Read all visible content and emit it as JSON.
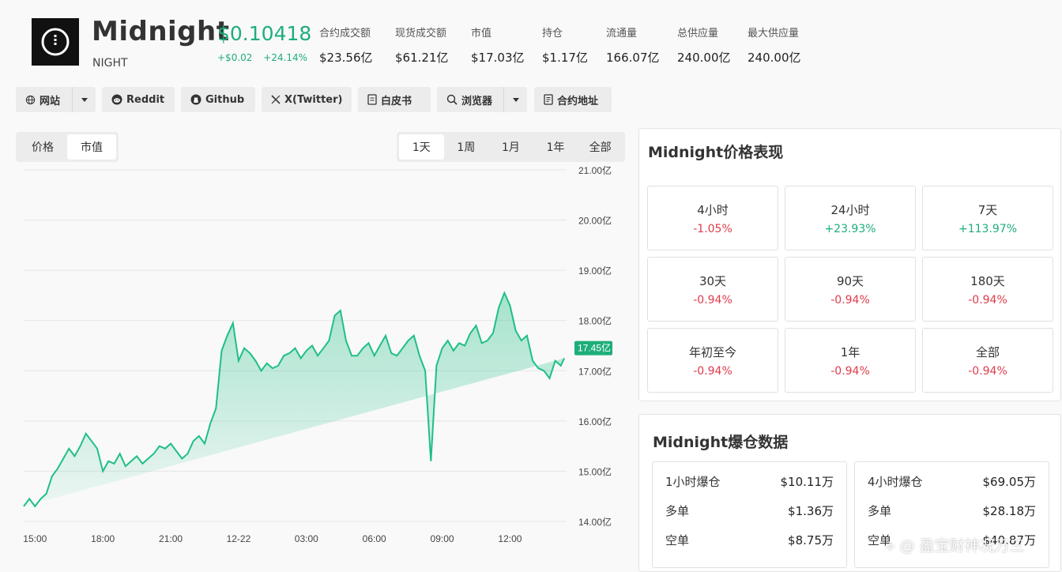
{
  "coin": {
    "name": "Midnight",
    "symbol": "NIGHT",
    "price": "$0.10418",
    "change_abs": "+$0.02",
    "change_pct": "+24.14%"
  },
  "stats": [
    {
      "label": "合约成交额",
      "value": "$23.56亿"
    },
    {
      "label": "现货成交额",
      "value": "$61.21亿"
    },
    {
      "label": "市值",
      "value": "$17.03亿"
    },
    {
      "label": "持仓",
      "value": "$1.17亿"
    },
    {
      "label": "流通量",
      "value": "166.07亿"
    },
    {
      "label": "总供应量",
      "value": "240.00亿"
    },
    {
      "label": "最大供应量",
      "value": "240.00亿"
    }
  ],
  "links": {
    "website": "网站",
    "reddit": "Reddit",
    "github": "Github",
    "twitter": "X(Twitter)",
    "whitepaper": "白皮书",
    "explorer": "浏览器",
    "contract": "合约地址"
  },
  "chart_toggle": {
    "price": "价格",
    "market_cap": "市值",
    "active": "市值"
  },
  "ranges": [
    "1天",
    "1周",
    "1月",
    "1年",
    "全部"
  ],
  "active_range": "1天",
  "chart_data": {
    "type": "area",
    "title": "",
    "xlabel": "",
    "ylabel": "",
    "unit": "亿",
    "color": "#1fbf85",
    "ylim": [
      14.0,
      21.0
    ],
    "y_ticks": [
      "21.00亿",
      "20.00亿",
      "19.00亿",
      "18.00亿",
      "17.00亿",
      "16.00亿",
      "15.00亿",
      "14.00亿"
    ],
    "x_ticks": [
      "15:00",
      "18:00",
      "21:00",
      "12-22",
      "03:00",
      "06:00",
      "09:00",
      "12:00"
    ],
    "current_label": "17.45亿",
    "current_value": 17.45,
    "x_hours": [
      0,
      0.25,
      0.5,
      0.75,
      1,
      1.25,
      1.5,
      1.75,
      2,
      2.25,
      2.5,
      2.75,
      3,
      3.25,
      3.5,
      3.75,
      4,
      4.25,
      4.5,
      4.75,
      5,
      5.25,
      5.5,
      5.75,
      6,
      6.25,
      6.5,
      6.75,
      7,
      7.25,
      7.5,
      7.75,
      8,
      8.25,
      8.5,
      8.75,
      9,
      9.25,
      9.5,
      9.75,
      10,
      10.25,
      10.5,
      10.75,
      11,
      11.25,
      11.5,
      11.75,
      12,
      12.25,
      12.5,
      12.75,
      13,
      13.25,
      13.5,
      13.75,
      14,
      14.25,
      14.5,
      14.75,
      15,
      15.25,
      15.5,
      15.75,
      16,
      16.25,
      16.5,
      16.75,
      17,
      17.25,
      17.5,
      17.75,
      18,
      18.25,
      18.5,
      18.75,
      19,
      19.25,
      19.5,
      19.75,
      20,
      20.25,
      20.5,
      20.75,
      21,
      21.25,
      21.5,
      21.75,
      22,
      22.25,
      22.5,
      22.75,
      23,
      23.25,
      23.5,
      23.75,
      23.9
    ],
    "values": [
      14.3,
      14.45,
      14.3,
      14.45,
      14.55,
      14.9,
      15.05,
      15.25,
      15.45,
      15.3,
      15.5,
      15.75,
      15.6,
      15.45,
      15.0,
      15.2,
      15.15,
      15.35,
      15.1,
      15.2,
      15.3,
      15.15,
      15.25,
      15.35,
      15.5,
      15.45,
      15.55,
      15.4,
      15.25,
      15.35,
      15.6,
      15.7,
      15.55,
      15.95,
      16.25,
      17.4,
      17.7,
      17.95,
      17.2,
      17.45,
      17.35,
      17.2,
      17.0,
      17.15,
      17.05,
      17.1,
      17.3,
      17.35,
      17.45,
      17.25,
      17.4,
      17.5,
      17.3,
      17.45,
      17.6,
      18.1,
      18.2,
      17.6,
      17.3,
      17.3,
      17.45,
      17.55,
      17.3,
      17.5,
      17.7,
      17.35,
      17.3,
      17.45,
      17.6,
      17.7,
      17.3,
      17.0,
      15.2,
      17.1,
      17.45,
      17.6,
      17.4,
      17.55,
      17.5,
      17.75,
      17.9,
      17.55,
      17.6,
      17.75,
      18.25,
      18.55,
      18.3,
      17.8,
      17.6,
      17.7,
      17.2,
      17.05,
      17.0,
      16.85,
      17.2,
      17.1,
      17.25,
      17.3,
      17.45
    ]
  },
  "perf": {
    "title": "Midnight价格表现",
    "cells": [
      {
        "period": "4小时",
        "value": "-1.05%",
        "dir": "neg"
      },
      {
        "period": "24小时",
        "value": "+23.93%",
        "dir": "pos"
      },
      {
        "period": "7天",
        "value": "+113.97%",
        "dir": "pos"
      },
      {
        "period": "30天",
        "value": "-0.94%",
        "dir": "neg"
      },
      {
        "period": "90天",
        "value": "-0.94%",
        "dir": "neg"
      },
      {
        "period": "180天",
        "value": "-0.94%",
        "dir": "neg"
      },
      {
        "period": "年初至今",
        "value": "-0.94%",
        "dir": "neg"
      },
      {
        "period": "1年",
        "value": "-0.94%",
        "dir": "neg"
      },
      {
        "period": "全部",
        "value": "-0.94%",
        "dir": "neg"
      }
    ]
  },
  "liquidation": {
    "title": "Midnight爆仓数据",
    "boxes": [
      {
        "header": "1小时爆仓",
        "total": "$10.11万",
        "long_label": "多单",
        "long": "$1.36万",
        "short_label": "空单",
        "short": "$8.75万"
      },
      {
        "header": "4小时爆仓",
        "total": "$69.05万",
        "long_label": "多单",
        "long": "$28.18万",
        "short_label": "空单",
        "short": "$40.87万"
      }
    ]
  },
  "watermark": "盈宝财神况万三",
  "colors": {
    "green": "#1eae7a",
    "red": "#e03b4b",
    "chart_line": "#1fbf85"
  }
}
